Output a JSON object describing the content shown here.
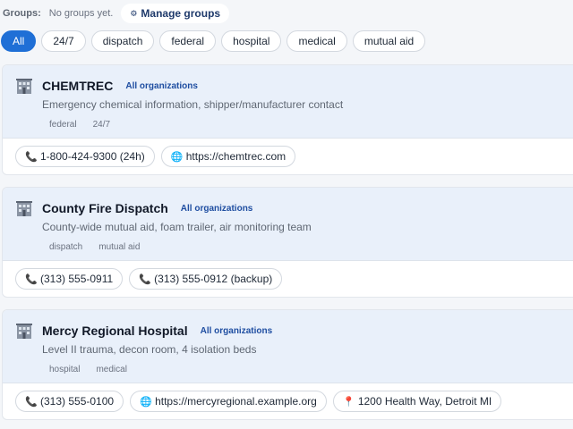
{
  "groups": {
    "label": "Groups:",
    "empty_text": "No groups yet.",
    "manage_label": "Manage groups"
  },
  "filters": [
    {
      "label": "All",
      "active": true
    },
    {
      "label": "24/7"
    },
    {
      "label": "dispatch"
    },
    {
      "label": "federal"
    },
    {
      "label": "hospital"
    },
    {
      "label": "medical"
    },
    {
      "label": "mutual aid"
    }
  ],
  "cards": [
    {
      "title": "CHEMTREC",
      "scope": "All organizations",
      "description": "Emergency chemical information, shipper/manufacturer contact",
      "tags": [
        "federal",
        "24/7"
      ],
      "contacts": [
        {
          "type": "phone",
          "text": "1-800-424-9300 (24h)"
        },
        {
          "type": "web",
          "text": "https://chemtrec.com"
        }
      ]
    },
    {
      "title": "County Fire Dispatch",
      "scope": "All organizations",
      "description": "County-wide mutual aid, foam trailer, air monitoring team",
      "tags": [
        "dispatch",
        "mutual aid"
      ],
      "contacts": [
        {
          "type": "phone",
          "text": "(313) 555-0911"
        },
        {
          "type": "phone",
          "text": "(313) 555-0912 (backup)"
        }
      ]
    },
    {
      "title": "Mercy Regional Hospital",
      "scope": "All organizations",
      "description": "Level II trauma, decon room, 4 isolation beds",
      "tags": [
        "hospital",
        "medical"
      ],
      "contacts": [
        {
          "type": "phone",
          "text": "(313) 555-0100"
        },
        {
          "type": "web",
          "text": "https://mercyregional.example.org"
        },
        {
          "type": "address",
          "text": "1200 Health Way, Detroit MI"
        }
      ]
    }
  ],
  "icons": {
    "card": "building-icon",
    "phone": "phone-icon",
    "web": "globe-icon",
    "address": "map-pin-icon",
    "manage": "gear-icon"
  },
  "colors": {
    "accent": "#1f6fd6",
    "scope_link": "#1f4ea1",
    "card_header_bg": "#e9f0fa"
  }
}
